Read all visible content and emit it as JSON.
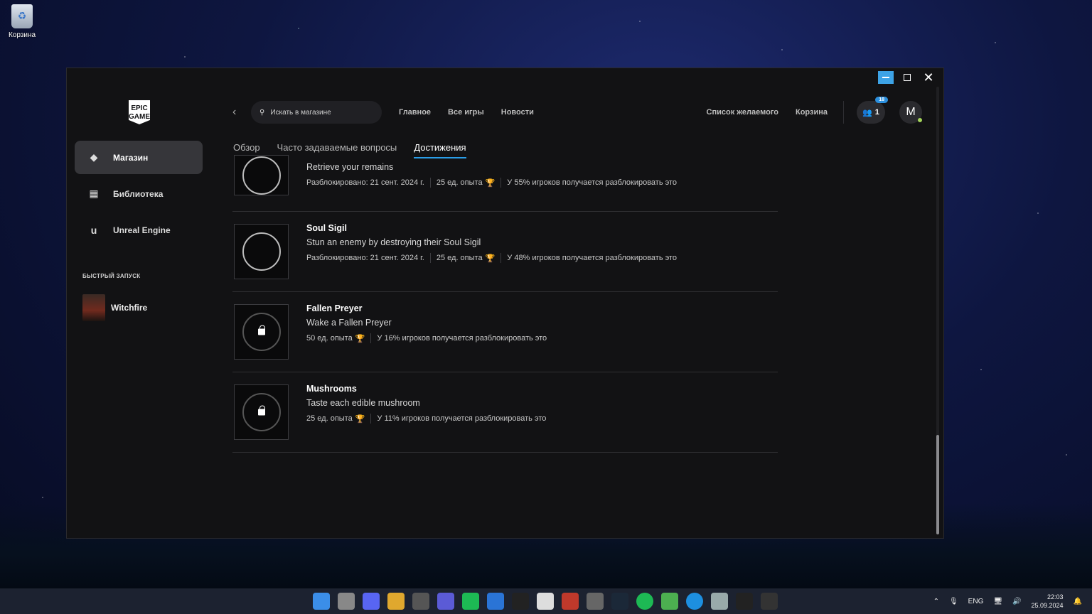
{
  "desktop": {
    "recycle_bin_label": "Корзина"
  },
  "sidebar": {
    "logo_text": "EPIC GAMES",
    "items": [
      {
        "label": "Магазин",
        "icon": "tag-icon"
      },
      {
        "label": "Библиотека",
        "icon": "grid-icon"
      },
      {
        "label": "Unreal Engine",
        "icon": "unreal-icon"
      }
    ],
    "quick_launch_title": "БЫСТРЫЙ ЗАПУСК",
    "quick_launch_items": [
      {
        "label": "Witchfire"
      }
    ]
  },
  "topbar": {
    "search_placeholder": "Искать в магазине",
    "nav": [
      "Главное",
      "Все игры",
      "Новости"
    ],
    "wishlist": "Список желаемого",
    "cart": "Корзина",
    "friends_count": "1",
    "friends_badge": "18",
    "avatar_letter": "M"
  },
  "tabs": [
    "Обзор",
    "Часто задаваемые вопросы",
    "Достижения"
  ],
  "achievements": [
    {
      "title": "",
      "description": "Retrieve your remains",
      "unlocked": "Разблокировано: 21 сент. 2024 г.",
      "xp": "25 ед. опыта",
      "percent": "У 55% игроков получается разблокировать это",
      "locked": false
    },
    {
      "title": "Soul Sigil",
      "description": "Stun an enemy by destroying their Soul Sigil",
      "unlocked": "Разблокировано: 21 сент. 2024 г.",
      "xp": "25 ед. опыта",
      "percent": "У 48% игроков получается разблокировать это",
      "locked": false
    },
    {
      "title": "Fallen Preyer",
      "description": "Wake a Fallen Preyer",
      "unlocked": "",
      "xp": "50 ед. опыта",
      "percent": "У 16% игроков получается разблокировать это",
      "locked": true
    },
    {
      "title": "Mushrooms",
      "description": "Taste each edible mushroom",
      "unlocked": "",
      "xp": "25 ед. опыта",
      "percent": "У 11% игроков получается разблокировать это",
      "locked": true
    }
  ],
  "taskbar": {
    "tray_lang": "ENG",
    "time": "22:03",
    "date": "25.09.2024"
  },
  "colors": {
    "accent": "#2a9de8",
    "trophy": "#c0392b",
    "window_bg": "#121214"
  }
}
